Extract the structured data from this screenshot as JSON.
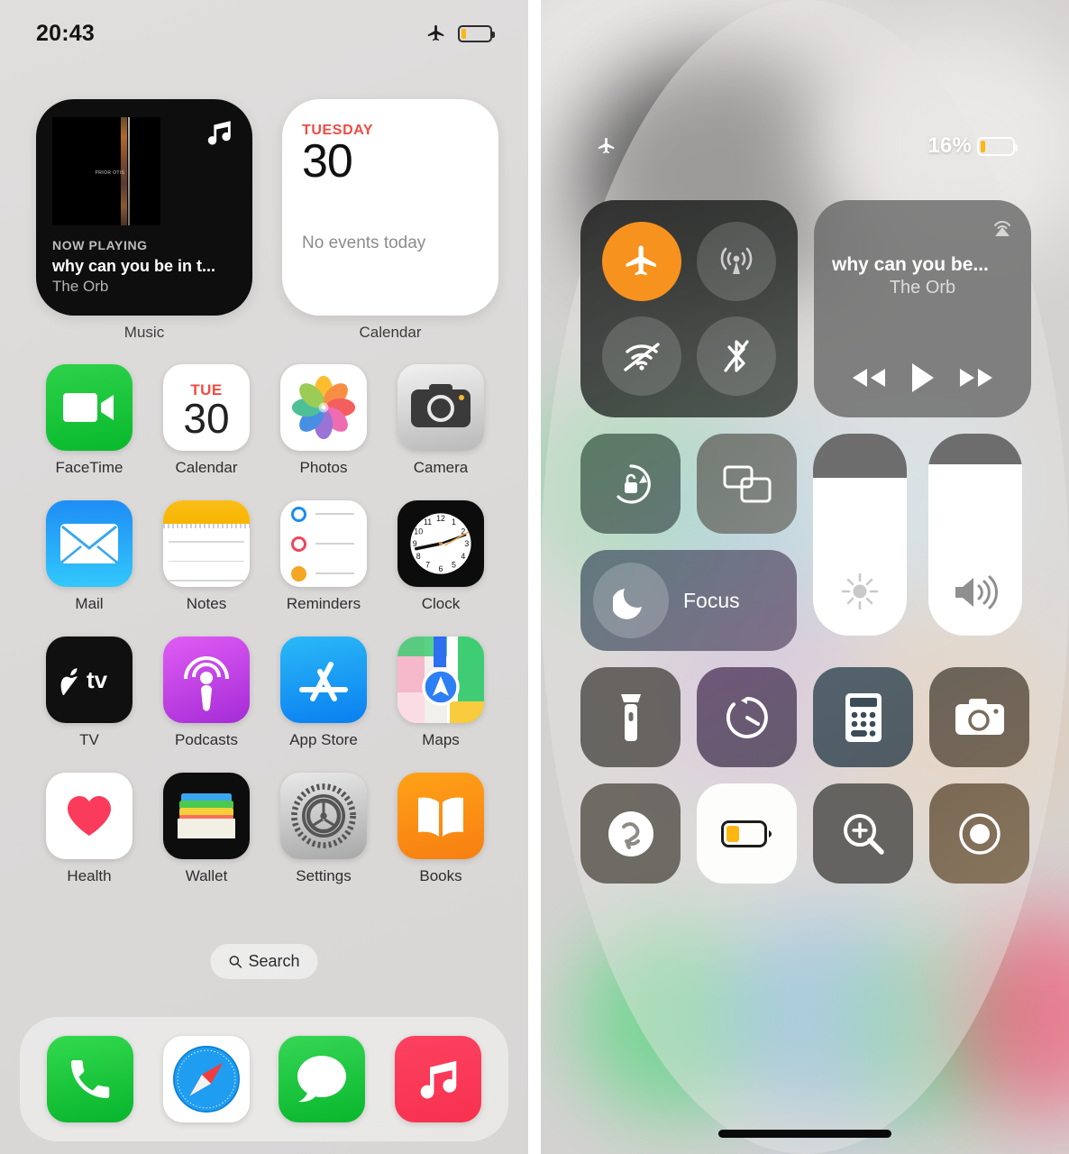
{
  "home": {
    "status_bar": {
      "time": "20:43",
      "airplane_icon": "airplane-icon",
      "battery_icon": "battery-low-icon",
      "battery_level_pct": 16
    },
    "widgets": [
      {
        "name": "music-widget",
        "label": "Music",
        "now_playing_label": "NOW PLAYING",
        "track_title": "why can you be in t...",
        "artist": "The Orb",
        "album_art_text": "PRIOR OTIS",
        "corner_icon": "music-note-icon"
      },
      {
        "name": "calendar-widget",
        "label": "Calendar",
        "day_of_week": "TUESDAY",
        "day_number": "30",
        "events_text": "No events today",
        "accent_color": "#f04b43"
      }
    ],
    "apps": [
      {
        "label": "FaceTime",
        "icon": "facetime-icon"
      },
      {
        "label": "Calendar",
        "icon": "calendar-icon",
        "dow": "TUE",
        "day": "30"
      },
      {
        "label": "Photos",
        "icon": "photos-icon"
      },
      {
        "label": "Camera",
        "icon": "camera-icon"
      },
      {
        "label": "Mail",
        "icon": "mail-icon"
      },
      {
        "label": "Notes",
        "icon": "notes-icon"
      },
      {
        "label": "Reminders",
        "icon": "reminders-icon"
      },
      {
        "label": "Clock",
        "icon": "clock-icon"
      },
      {
        "label": "TV",
        "icon": "tv-icon"
      },
      {
        "label": "Podcasts",
        "icon": "podcasts-icon"
      },
      {
        "label": "App Store",
        "icon": "app-store-icon"
      },
      {
        "label": "Maps",
        "icon": "maps-icon"
      },
      {
        "label": "Health",
        "icon": "health-icon"
      },
      {
        "label": "Wallet",
        "icon": "wallet-icon"
      },
      {
        "label": "Settings",
        "icon": "settings-icon"
      },
      {
        "label": "Books",
        "icon": "books-icon"
      }
    ],
    "search": {
      "label": "Search",
      "icon": "search-icon"
    },
    "dock": [
      {
        "label": "Phone",
        "icon": "phone-icon"
      },
      {
        "label": "Safari",
        "icon": "safari-icon"
      },
      {
        "label": "Messages",
        "icon": "messages-icon"
      },
      {
        "label": "Music",
        "icon": "music-icon"
      }
    ]
  },
  "control_center": {
    "status_bar": {
      "airplane_icon": "airplane-icon",
      "battery_percent": "16%",
      "battery_level_pct": 16
    },
    "connectivity": [
      {
        "name": "airplane-mode-toggle",
        "icon": "airplane-icon",
        "state": "on",
        "color": "#f7921e"
      },
      {
        "name": "cellular-data-toggle",
        "icon": "cellular-icon",
        "state": "off"
      },
      {
        "name": "wifi-toggle",
        "icon": "wifi-off-icon",
        "state": "off"
      },
      {
        "name": "bluetooth-toggle",
        "icon": "bluetooth-off-icon",
        "state": "off"
      }
    ],
    "media": {
      "track_title": "why can you be...",
      "artist": "The Orb",
      "airplay_icon": "airplay-icon",
      "controls": [
        {
          "name": "rewind-button",
          "icon": "rewind-icon"
        },
        {
          "name": "play-button",
          "icon": "play-icon"
        },
        {
          "name": "forward-button",
          "icon": "forward-icon"
        }
      ]
    },
    "tiles_small": [
      {
        "name": "rotation-lock-toggle",
        "icon": "rotation-lock-icon"
      },
      {
        "name": "screen-mirroring-button",
        "icon": "screen-mirroring-icon"
      }
    ],
    "focus": {
      "label": "Focus",
      "icon": "moon-icon"
    },
    "sliders": [
      {
        "name": "brightness-slider",
        "icon": "brightness-icon",
        "value_pct": 78
      },
      {
        "name": "volume-slider",
        "icon": "volume-icon",
        "value_pct": 85
      }
    ],
    "controls_row_1": [
      {
        "name": "flashlight-button",
        "icon": "flashlight-icon"
      },
      {
        "name": "timer-button",
        "icon": "timer-icon"
      },
      {
        "name": "calculator-button",
        "icon": "calculator-icon"
      },
      {
        "name": "camera-button",
        "icon": "camera-icon"
      }
    ],
    "controls_row_2": [
      {
        "name": "shazam-button",
        "icon": "shazam-icon"
      },
      {
        "name": "low-power-mode-toggle",
        "icon": "battery-low-icon",
        "state": "on"
      },
      {
        "name": "magnifier-button",
        "icon": "magnifier-icon"
      },
      {
        "name": "screen-record-button",
        "icon": "record-icon"
      }
    ]
  }
}
